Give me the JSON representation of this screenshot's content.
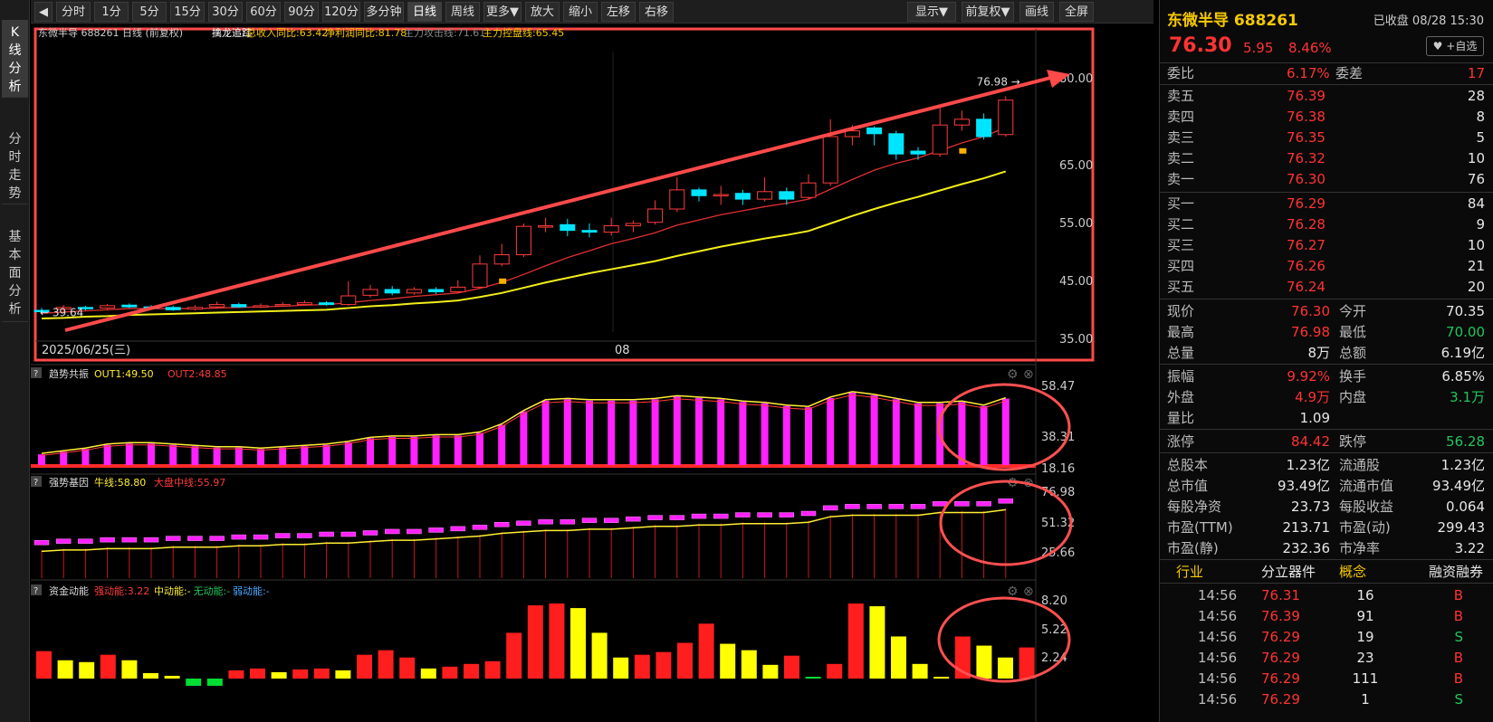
{
  "side_tabs": [
    "K线分析",
    "分时走势",
    "基本面分析"
  ],
  "toolbar": {
    "items": [
      "分时",
      "1分",
      "5分",
      "15分",
      "30分",
      "60分",
      "90分",
      "120分",
      "多分钟",
      "日线",
      "周线",
      "更多▼",
      "放大",
      "缩小",
      "左移",
      "右移"
    ],
    "active": "日线",
    "right_items": [
      "显示▼",
      "前复权▼",
      "画线",
      "全屏"
    ]
  },
  "main_panel": {
    "legend_name": "东微半导 688261 日线 (前复权)",
    "legend_items": [
      {
        "label": "擒龙追踪",
        "color": "#ffffff"
      },
      {
        "label": "总收入同比:63.42",
        "color": "#f6c900"
      },
      {
        "label": "净利润同比:81.78",
        "color": "#f6c900"
      },
      {
        "label": "主力攻击线:71.61",
        "color": "#888888"
      },
      {
        "label": "主力控盘线:65.45",
        "color": "#f6c900"
      }
    ],
    "start_date": "2025/06/25(三)",
    "mid_label": "08",
    "high_label": "76.98",
    "low_label": "39.64",
    "yticks": [
      80,
      65,
      55,
      45,
      35
    ]
  },
  "sub1": {
    "title": "趋势共振",
    "out1": "OUT1:49.50",
    "out2": "OUT2:48.85",
    "yticks": [
      "58.47",
      "38.31",
      "18.16"
    ]
  },
  "sub2": {
    "title": "强势基因",
    "a": "牛线:58.80",
    "b": "大盘中线:55.97",
    "yticks": [
      "76.98",
      "51.32",
      "25.66"
    ]
  },
  "sub3": {
    "title": "资金动能",
    "a": "强动能:3.22",
    "b": "中动能:-",
    "c": "无动能:-",
    "d": "弱动能:-",
    "yticks": [
      "8.20",
      "5.22",
      "2.24"
    ]
  },
  "chart_data": {
    "type": "candlestick",
    "dates_start": "2025/06/25",
    "candles": [
      [
        40.0,
        39.8,
        40.4,
        39.6
      ],
      [
        40.2,
        40.5,
        40.9,
        39.9
      ],
      [
        40.5,
        40.3,
        40.8,
        40.0
      ],
      [
        40.4,
        40.8,
        41.1,
        40.2
      ],
      [
        40.9,
        40.6,
        41.2,
        40.4
      ],
      [
        40.6,
        40.4,
        40.9,
        40.2
      ],
      [
        40.5,
        40.1,
        40.8,
        39.9
      ],
      [
        40.2,
        40.5,
        40.9,
        40.0
      ],
      [
        40.6,
        41.0,
        41.5,
        40.3
      ],
      [
        41.0,
        40.6,
        41.3,
        40.4
      ],
      [
        40.6,
        40.8,
        41.2,
        40.4
      ],
      [
        40.8,
        41.0,
        41.4,
        40.6
      ],
      [
        41.0,
        41.3,
        41.7,
        40.9
      ],
      [
        41.3,
        41.0,
        41.6,
        40.8
      ],
      [
        41.0,
        42.5,
        45.0,
        40.8
      ],
      [
        42.6,
        43.6,
        44.4,
        42.2
      ],
      [
        43.6,
        43.0,
        44.2,
        42.6
      ],
      [
        43.0,
        43.6,
        44.0,
        42.7
      ],
      [
        43.6,
        43.2,
        44.0,
        42.8
      ],
      [
        43.2,
        44.0,
        45.2,
        42.9
      ],
      [
        44.0,
        48.0,
        49.5,
        43.8
      ],
      [
        48.0,
        49.6,
        51.5,
        47.6
      ],
      [
        49.6,
        54.5,
        55.0,
        49.2
      ],
      [
        54.5,
        54.6,
        56.0,
        53.5
      ],
      [
        54.8,
        53.8,
        55.8,
        52.8
      ],
      [
        53.8,
        53.5,
        55.0,
        52.6
      ],
      [
        53.5,
        54.6,
        56.0,
        52.9
      ],
      [
        54.6,
        55.0,
        55.5,
        53.5
      ],
      [
        55.2,
        57.5,
        59.0,
        54.8
      ],
      [
        57.5,
        60.8,
        63.0,
        57.0
      ],
      [
        60.8,
        59.8,
        61.2,
        58.8
      ],
      [
        59.8,
        60.0,
        61.5,
        58.2
      ],
      [
        60.2,
        59.2,
        60.8,
        58.2
      ],
      [
        59.2,
        60.5,
        63.0,
        58.8
      ],
      [
        60.5,
        59.2,
        61.2,
        58.2
      ],
      [
        59.5,
        62.0,
        63.5,
        59.2
      ],
      [
        62.0,
        70.0,
        73.0,
        61.5
      ],
      [
        70.0,
        71.0,
        72.0,
        68.5
      ],
      [
        71.5,
        70.5,
        71.8,
        68.5
      ],
      [
        70.5,
        67.0,
        71.0,
        66.0
      ],
      [
        67.5,
        67.0,
        68.2,
        66.0
      ],
      [
        67.0,
        72.0,
        75.0,
        66.5
      ],
      [
        72.0,
        73.0,
        74.5,
        71.0
      ],
      [
        73.0,
        70.0,
        74.0,
        69.5
      ],
      [
        70.35,
        76.3,
        76.98,
        70.0
      ]
    ],
    "ma_red": [
      39.5,
      39.7,
      39.9,
      40.1,
      40.3,
      40.3,
      40.3,
      40.3,
      40.4,
      40.5,
      40.6,
      40.7,
      40.9,
      41.0,
      41.3,
      41.7,
      42.0,
      42.4,
      42.7,
      43.0,
      43.8,
      44.8,
      46.2,
      47.7,
      49.1,
      50.3,
      51.5,
      52.4,
      53.4,
      54.7,
      55.6,
      56.5,
      57.2,
      57.9,
      58.5,
      59.2,
      60.9,
      62.6,
      64.2,
      65.4,
      66.3,
      67.6,
      68.9,
      70.0,
      71.6
    ],
    "ma_yellow": [
      38.6,
      38.7,
      38.9,
      39.0,
      39.2,
      39.3,
      39.4,
      39.5,
      39.6,
      39.7,
      39.8,
      39.9,
      40.0,
      40.1,
      40.4,
      40.7,
      40.9,
      41.2,
      41.4,
      41.7,
      42.3,
      43.0,
      43.9,
      44.8,
      45.6,
      46.4,
      47.1,
      47.8,
      48.5,
      49.4,
      50.2,
      51.0,
      51.7,
      52.4,
      53.0,
      53.7,
      55.0,
      56.3,
      57.5,
      58.6,
      59.6,
      60.7,
      61.8,
      62.8,
      64.0
    ],
    "sub1_bars": [
      8,
      10,
      12,
      15,
      16,
      16,
      15,
      14,
      13,
      13,
      12,
      13,
      14,
      15,
      17,
      20,
      21,
      21,
      22,
      22,
      24,
      30,
      40,
      48,
      49,
      48,
      48,
      48,
      49,
      51,
      50,
      49,
      47,
      46,
      44,
      43,
      50,
      54,
      52,
      49,
      46,
      46,
      47,
      44,
      49.5
    ],
    "sub2_values": [
      44,
      45,
      45,
      46,
      46,
      46,
      47,
      47,
      47,
      48,
      48,
      49,
      49,
      50,
      50,
      51,
      52,
      52,
      53,
      54,
      55,
      57,
      58,
      59,
      59,
      60,
      60,
      61,
      62,
      62,
      63,
      63,
      64,
      64,
      64,
      65,
      69,
      70,
      70,
      70,
      70,
      72,
      72,
      72,
      74
    ],
    "sub3_bars": [
      [
        3.0,
        "r"
      ],
      [
        2.0,
        "y"
      ],
      [
        1.8,
        "y"
      ],
      [
        2.6,
        "r"
      ],
      [
        2.0,
        "y"
      ],
      [
        0.6,
        "y"
      ],
      [
        0.3,
        "y"
      ],
      [
        -0.8,
        "g"
      ],
      [
        -0.8,
        "g"
      ],
      [
        0.9,
        "r"
      ],
      [
        1.1,
        "r"
      ],
      [
        0.7,
        "y"
      ],
      [
        1.0,
        "r"
      ],
      [
        1.1,
        "r"
      ],
      [
        0.9,
        "y"
      ],
      [
        2.6,
        "r"
      ],
      [
        3.1,
        "r"
      ],
      [
        2.3,
        "r"
      ],
      [
        1.1,
        "y"
      ],
      [
        1.3,
        "r"
      ],
      [
        1.6,
        "r"
      ],
      [
        1.9,
        "r"
      ],
      [
        5.0,
        "r"
      ],
      [
        8.0,
        "r"
      ],
      [
        8.2,
        "r"
      ],
      [
        7.7,
        "y"
      ],
      [
        5.0,
        "y"
      ],
      [
        2.3,
        "y"
      ],
      [
        2.6,
        "r"
      ],
      [
        2.9,
        "r"
      ],
      [
        3.9,
        "r"
      ],
      [
        6.0,
        "r"
      ],
      [
        3.8,
        "y"
      ],
      [
        3.1,
        "y"
      ],
      [
        1.5,
        "y"
      ],
      [
        2.5,
        "r"
      ],
      [
        0.2,
        "g"
      ],
      [
        1.6,
        "r"
      ],
      [
        8.2,
        "r"
      ],
      [
        7.9,
        "y"
      ],
      [
        4.6,
        "y"
      ],
      [
        1.6,
        "y"
      ],
      [
        0.2,
        "y"
      ],
      [
        4.6,
        "r"
      ],
      [
        3.6,
        "y"
      ],
      [
        2.3,
        "y"
      ],
      [
        3.4,
        "r"
      ]
    ]
  },
  "quote": {
    "name": "东微半导 688261",
    "status": "已收盘 08/28 15:30",
    "price": "76.30",
    "change": "5.95",
    "pct": "8.46%",
    "fav": "+自选",
    "weibi_label": "委比",
    "weibi": "6.17%",
    "weicha_label": "委差",
    "weicha": "17",
    "asks": [
      [
        "卖五",
        "76.39",
        "28"
      ],
      [
        "卖四",
        "76.38",
        "8"
      ],
      [
        "卖三",
        "76.35",
        "5"
      ],
      [
        "卖二",
        "76.32",
        "10"
      ],
      [
        "卖一",
        "76.30",
        "76"
      ]
    ],
    "bids": [
      [
        "买一",
        "76.29",
        "84"
      ],
      [
        "买二",
        "76.28",
        "9"
      ],
      [
        "买三",
        "76.27",
        "10"
      ],
      [
        "买四",
        "76.26",
        "21"
      ],
      [
        "买五",
        "76.24",
        "20"
      ]
    ],
    "stats": [
      [
        [
          "现价",
          "76.30",
          "red"
        ],
        [
          "今开",
          "70.35",
          "wht"
        ]
      ],
      [
        [
          "最高",
          "76.98",
          "red"
        ],
        [
          "最低",
          "70.00",
          "grn"
        ]
      ],
      [
        [
          "总量",
          "8万",
          "wht"
        ],
        [
          "总额",
          "6.19亿",
          "wht"
        ]
      ],
      [
        [
          "振幅",
          "9.92%",
          "red"
        ],
        [
          "换手",
          "6.85%",
          "wht"
        ]
      ],
      [
        [
          "外盘",
          "4.9万",
          "red"
        ],
        [
          "内盘",
          "3.1万",
          "grn"
        ]
      ],
      [
        [
          "量比",
          "1.09",
          "wht"
        ]
      ],
      [
        [
          "涨停",
          "84.42",
          "red"
        ],
        [
          "跌停",
          "56.28",
          "grn"
        ]
      ],
      [
        [
          "总股本",
          "1.23亿",
          "wht"
        ],
        [
          "流通股",
          "1.23亿",
          "wht"
        ]
      ],
      [
        [
          "总市值",
          "93.49亿",
          "wht"
        ],
        [
          "流通市值",
          "93.49亿",
          "wht"
        ]
      ],
      [
        [
          "每股净资",
          "23.73",
          "wht"
        ],
        [
          "每股收益",
          "0.064",
          "wht"
        ]
      ],
      [
        [
          "市盈(TTM)",
          "213.71",
          "wht"
        ],
        [
          "市盈(动)",
          "299.43",
          "wht"
        ]
      ],
      [
        [
          "市盈(静)",
          "232.36",
          "wht"
        ],
        [
          "市净率",
          "3.22",
          "wht"
        ]
      ]
    ],
    "industry_label": "行业",
    "industry": "分立器件",
    "concept_label": "概念",
    "margin_label": "融资融券",
    "trades": [
      [
        "14:56",
        "76.31",
        "16",
        "B"
      ],
      [
        "14:56",
        "76.39",
        "91",
        "B"
      ],
      [
        "14:56",
        "76.29",
        "19",
        "S"
      ],
      [
        "14:56",
        "76.29",
        "23",
        "B"
      ],
      [
        "14:56",
        "76.29",
        "111",
        "B"
      ],
      [
        "14:56",
        "76.29",
        "1",
        "S"
      ]
    ]
  }
}
